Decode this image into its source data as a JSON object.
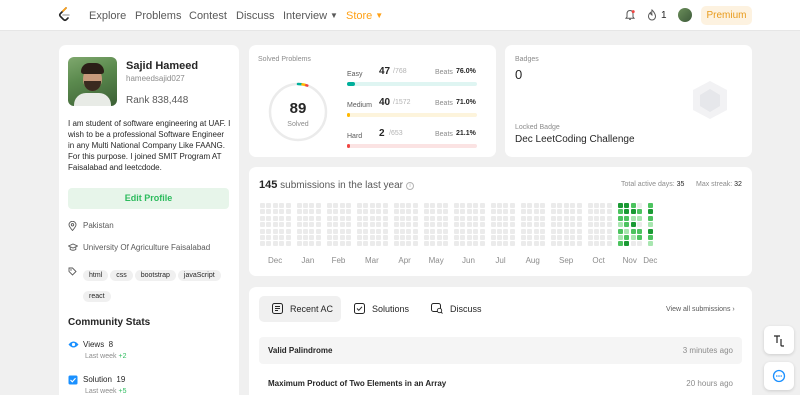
{
  "nav": {
    "items": [
      "Explore",
      "Problems",
      "Contest",
      "Discuss",
      "Interview",
      "Store"
    ],
    "streak": "1",
    "premium_label": "Premium"
  },
  "profile": {
    "name": "Sajid Hameed",
    "username": "hameedsajid027",
    "rank_label": "Rank 838,448",
    "bio": "I am student of software engineering at UAF. I wish to be a professional Software Engineer in any Multi National Company Like FAANG. For this purpose. I joined SMIT Program AT Faisalabad and leetcdode.",
    "edit_label": "Edit Profile",
    "location": "Pakistan",
    "university": "University Of Agriculture Faisalabad",
    "tags": [
      "html",
      "css",
      "bootstrap",
      "javaScript",
      "react"
    ]
  },
  "community": {
    "title": "Community Stats",
    "stats": [
      {
        "label": "Views",
        "value": "8",
        "sub_label": "Last week",
        "sub_value": "+2"
      },
      {
        "label": "Solution",
        "value": "19",
        "sub_label": "Last week",
        "sub_value": "+5"
      }
    ]
  },
  "solved": {
    "label": "Solved Problems",
    "total": "89",
    "total_sub": "Solved",
    "beats_label": "Beats",
    "difficulties": [
      {
        "name": "Easy",
        "solved": "47",
        "total": "/768",
        "beats": "76.0%",
        "progress": 0.061,
        "color": "#00af9b",
        "track": "#dff5f2"
      },
      {
        "name": "Medium",
        "solved": "40",
        "total": "/1572",
        "beats": "71.0%",
        "progress": 0.025,
        "color": "#ffb800",
        "track": "#fdf4dc"
      },
      {
        "name": "Hard",
        "solved": "2",
        "total": "/653",
        "beats": "21.1%",
        "progress": 0.003,
        "color": "#ef4743",
        "track": "#fbe3e3"
      }
    ],
    "ring": {
      "easy": 0.0199,
      "medium": 0.0169,
      "hard": 0.0008
    }
  },
  "badges": {
    "label": "Badges",
    "count": "0",
    "locked_label": "Locked Badge",
    "locked_name": "Dec LeetCoding Challenge"
  },
  "submissions": {
    "count": "145",
    "title_suffix": "submissions in the last year",
    "active_days_label": "Total active days:",
    "active_days": "35",
    "max_streak_label": "Max streak:",
    "max_streak": "32",
    "months": [
      "Dec",
      "Jan",
      "Feb",
      "Mar",
      "Apr",
      "May",
      "Jun",
      "Jul",
      "Aug",
      "Sep",
      "Oct",
      "Nov",
      "Dec"
    ],
    "active_cells": [
      {
        "week": 48,
        "day": 0,
        "level": 3
      },
      {
        "week": 48,
        "day": 1,
        "level": 2
      },
      {
        "week": 48,
        "day": 2,
        "level": 2
      },
      {
        "week": 48,
        "day": 3,
        "level": 1
      },
      {
        "week": 48,
        "day": 4,
        "level": 2
      },
      {
        "week": 48,
        "day": 5,
        "level": 1
      },
      {
        "week": 48,
        "day": 6,
        "level": 2
      },
      {
        "week": 49,
        "day": 0,
        "level": 3
      },
      {
        "week": 49,
        "day": 1,
        "level": 3
      },
      {
        "week": 49,
        "day": 2,
        "level": 2
      },
      {
        "week": 49,
        "day": 3,
        "level": 2
      },
      {
        "week": 49,
        "day": 4,
        "level": 1
      },
      {
        "week": 49,
        "day": 5,
        "level": 2
      },
      {
        "week": 49,
        "day": 6,
        "level": 3
      },
      {
        "week": 50,
        "day": 0,
        "level": 2
      },
      {
        "week": 50,
        "day": 1,
        "level": 3
      },
      {
        "week": 50,
        "day": 2,
        "level": 1
      },
      {
        "week": 50,
        "day": 3,
        "level": 3
      },
      {
        "week": 50,
        "day": 4,
        "level": 2
      },
      {
        "week": 50,
        "day": 5,
        "level": 1
      },
      {
        "week": 51,
        "day": 1,
        "level": 2
      },
      {
        "week": 51,
        "day": 2,
        "level": 1
      },
      {
        "week": 51,
        "day": 4,
        "level": 2
      },
      {
        "week": 51,
        "day": 5,
        "level": 2
      },
      {
        "week": 52,
        "day": 0,
        "level": 2
      },
      {
        "week": 52,
        "day": 1,
        "level": 3
      },
      {
        "week": 52,
        "day": 2,
        "level": 2
      },
      {
        "week": 52,
        "day": 3,
        "level": 1
      },
      {
        "week": 52,
        "day": 4,
        "level": 3
      },
      {
        "week": 52,
        "day": 5,
        "level": 2
      },
      {
        "week": 52,
        "day": 6,
        "level": 1
      },
      {
        "week": 53,
        "day": 0,
        "level": 1
      },
      {
        "week": 53,
        "day": 1,
        "level": 2
      },
      {
        "week": 53,
        "day": 2,
        "level": 1
      },
      {
        "week": 53,
        "day": 3,
        "level": 2
      }
    ],
    "level_colors": [
      "#ebebeb",
      "#a8e6b0",
      "#4cc35f",
      "#1a9a34"
    ]
  },
  "activity": {
    "tabs": [
      "Recent AC",
      "Solutions",
      "Discuss"
    ],
    "view_all": "View all submissions",
    "rows": [
      {
        "title": "Valid Palindrome",
        "time": "3 minutes ago"
      },
      {
        "title": "Maximum Product of Two Elements in an Array",
        "time": "20 hours ago"
      }
    ]
  }
}
